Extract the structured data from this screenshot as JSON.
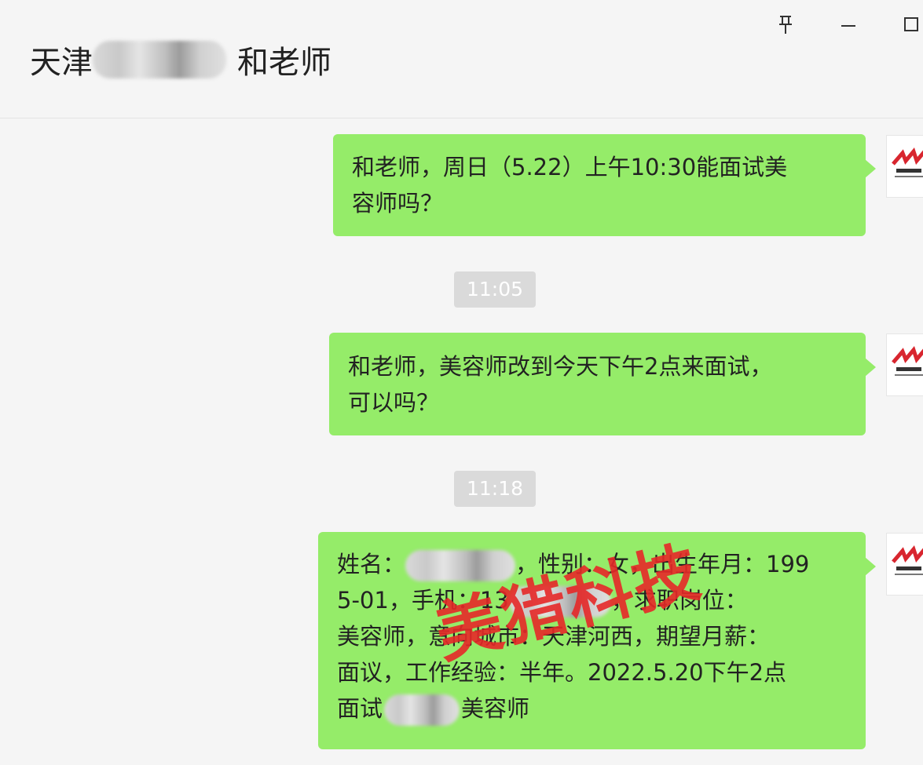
{
  "header": {
    "title_prefix": "天津",
    "title_suffix": "和老师"
  },
  "window_controls": {
    "pin": "pin-icon",
    "minimize": "minimize-icon",
    "maximize": "maximize-icon"
  },
  "messages": [
    {
      "text": "和老师，周日（5.22）上午10:30能面试美容师吗？",
      "line1": "和老师，周日（5.22）上午10:30能面试美",
      "line2": "容师吗？"
    },
    {
      "text": "和老师，美容师改到今天下午2点来面试，可以吗？",
      "line1": "和老师，美容师改到今天下午2点来面试，",
      "line2": "可以吗？"
    },
    {
      "l1a": "姓名：",
      "l1b": "，性别：女，出生年月：199",
      "l2a": "5-01，手机：13",
      "l2b": "，求职岗位：",
      "l3": "美容师，意向城市：天津河西，期望月薪：",
      "l4": "面议，工作经验：半年。2022.5.20下午2点",
      "l5a": "面试",
      "l5b": "美容师"
    }
  ],
  "timestamps": [
    "11:05",
    "11:18"
  ],
  "watermark": "美猎科技",
  "colors": {
    "bubble": "#95ec69",
    "background": "#f5f5f5",
    "timestamp_bg": "#dadada",
    "watermark": "#e62828",
    "logo_red": "#d8262f"
  }
}
